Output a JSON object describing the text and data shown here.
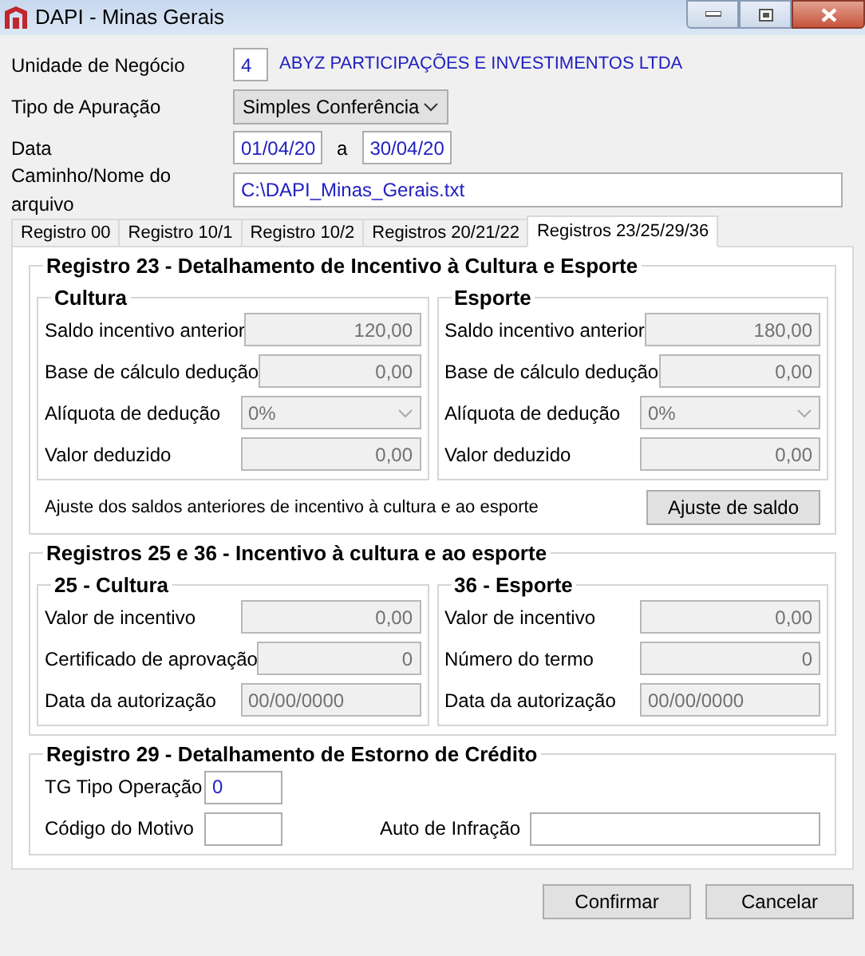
{
  "window": {
    "title": "DAPI - Minas Gerais"
  },
  "header": {
    "unidade": {
      "label": "Unidade de Negócio",
      "code": "4",
      "name": "ABYZ PARTICIPAÇÕES E INVESTIMENTOS LTDA"
    },
    "tipo": {
      "label": "Tipo de Apuração",
      "value": "Simples Conferência"
    },
    "data": {
      "label": "Data",
      "from": "01/04/20",
      "sep": "a",
      "to": "30/04/20"
    },
    "caminho": {
      "label": "Caminho/Nome do arquivo",
      "value": "C:\\DAPI_Minas_Gerais.txt"
    }
  },
  "tabs": [
    {
      "label": "Registro 00",
      "selected": false
    },
    {
      "label": "Registro 10/1",
      "selected": false
    },
    {
      "label": "Registro 10/2",
      "selected": false
    },
    {
      "label": "Registros 20/21/22",
      "selected": false
    },
    {
      "label": "Registros 23/25/29/36",
      "selected": true
    }
  ],
  "registro23": {
    "title": "Registro 23 - Detalhamento de Incentivo à Cultura e Esporte",
    "groups": [
      {
        "title": "Cultura",
        "fields": [
          {
            "label": "Saldo incentivo anterior",
            "kind": "number",
            "value": "120,00",
            "disabled": true
          },
          {
            "label": "Base de cálculo dedução",
            "kind": "number",
            "value": "0,00",
            "disabled": true
          },
          {
            "label": "Alíquota de dedução",
            "kind": "select",
            "value": "0%",
            "disabled": true
          },
          {
            "label": "Valor deduzido",
            "kind": "number",
            "value": "0,00",
            "disabled": true
          }
        ]
      },
      {
        "title": "Esporte",
        "fields": [
          {
            "label": "Saldo incentivo anterior",
            "kind": "number",
            "value": "180,00",
            "disabled": true
          },
          {
            "label": "Base de cálculo dedução",
            "kind": "number",
            "value": "0,00",
            "disabled": true
          },
          {
            "label": "Alíquota de dedução",
            "kind": "select",
            "value": "0%",
            "disabled": true
          },
          {
            "label": "Valor deduzido",
            "kind": "number",
            "value": "0,00",
            "disabled": true
          }
        ]
      }
    ],
    "note": "Ajuste dos saldos anteriores de incentivo à cultura e ao esporte",
    "button": "Ajuste de saldo"
  },
  "registros25_36": {
    "title": "Registros 25 e 36 - Incentivo à cultura e ao esporte",
    "groups": [
      {
        "title": "25 - Cultura",
        "fields": [
          {
            "label": "Valor de incentivo",
            "kind": "number",
            "value": "0,00",
            "disabled": true
          },
          {
            "label": "Certificado de aprovação",
            "kind": "number",
            "value": "0",
            "disabled": true
          },
          {
            "label": "Data da autorização",
            "kind": "text",
            "value": "00/00/0000",
            "disabled": true
          }
        ]
      },
      {
        "title": "36 - Esporte",
        "fields": [
          {
            "label": "Valor de incentivo",
            "kind": "number",
            "value": "0,00",
            "disabled": true
          },
          {
            "label": "Número do termo",
            "kind": "number",
            "value": "0",
            "disabled": true
          },
          {
            "label": "Data da autorização",
            "kind": "text",
            "value": "00/00/0000",
            "disabled": true
          }
        ]
      }
    ]
  },
  "registro29": {
    "title": "Registro 29 - Detalhamento de Estorno de Crédito",
    "tipo": {
      "label": "TG Tipo Operação",
      "value": "0"
    },
    "motivo": {
      "label": "Código do Motivo"
    },
    "auto": {
      "label": "Auto de Infração"
    }
  },
  "buttons": [
    "Confirmar",
    "Cancelar"
  ]
}
